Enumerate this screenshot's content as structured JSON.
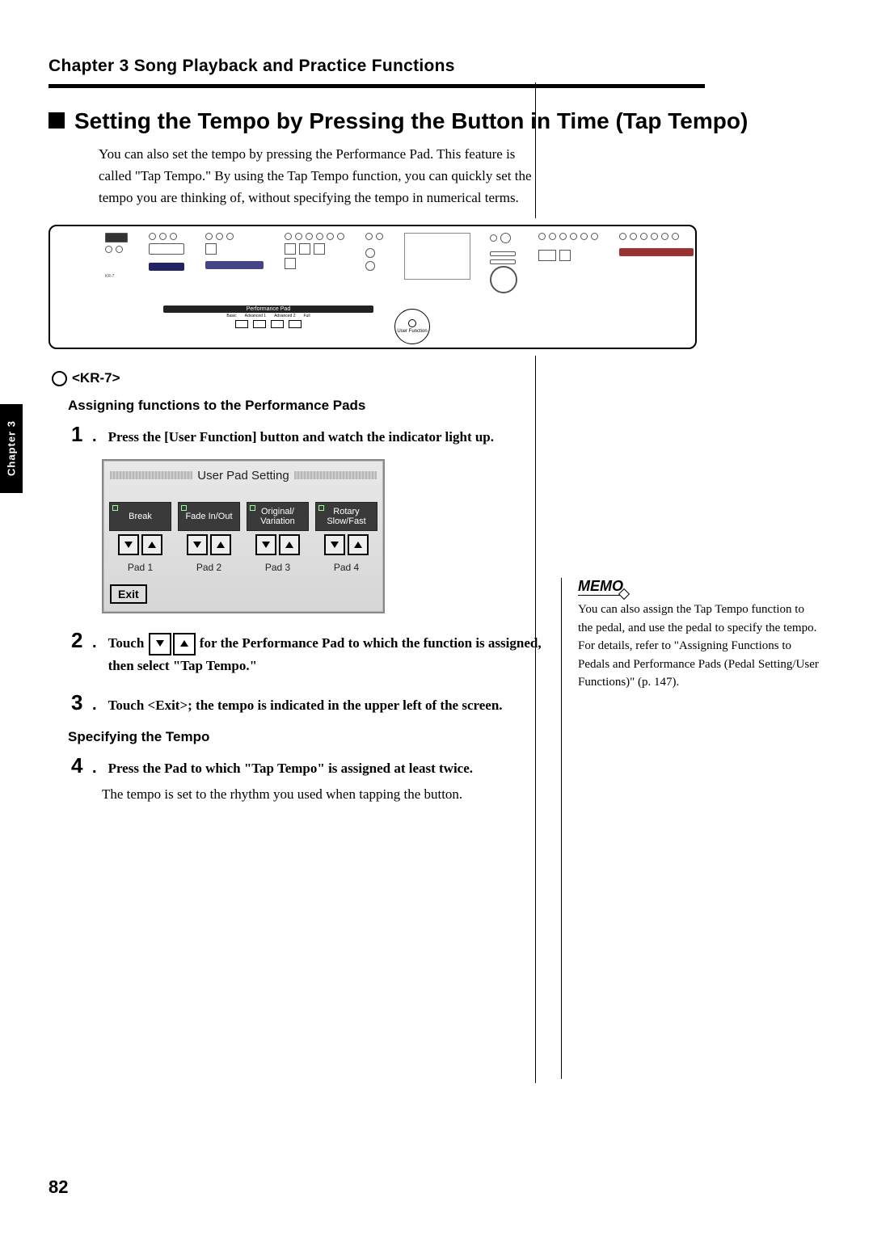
{
  "header": {
    "chapter_line": "Chapter 3 Song Playback and Practice Functions"
  },
  "section": {
    "title": "Setting the Tempo by Pressing the Button in Time (Tap Tempo)",
    "intro": "You can also set the tempo by pressing the Performance Pad. This feature is called \"Tap Tempo.\" By using the Tap Tempo function, you can quickly set the tempo you are thinking of, without specifying the tempo in numerical terms."
  },
  "panel": {
    "perf_label": "Performance Pad",
    "perf_btns": [
      "Basic",
      "Advanced 1",
      "Advanced 2",
      "Full"
    ],
    "circle_label": "User Function",
    "model": "KR-7"
  },
  "kr7": {
    "label": "<KR-7>"
  },
  "sub1": "Assigning functions to the Performance Pads",
  "steps": {
    "s1": "Press the [User Function] button and watch the indicator light up.",
    "s2a": "Touch ",
    "s2b": " for the Performance Pad to which the function is assigned, then select \"Tap Tempo.\"",
    "s3": "Touch <Exit>; the tempo is indicated in the upper left of the screen.",
    "s4": "Press the Pad to which \"Tap Tempo\" is assigned at least twice.",
    "s4_sub": "The tempo is set to the rhythm you used when tapping the button."
  },
  "sub2": "Specifying the Tempo",
  "lcd": {
    "title": "User Pad Setting",
    "pads": [
      {
        "cell": "Break",
        "label": "Pad 1"
      },
      {
        "cell": "Fade In/Out",
        "label": "Pad 2"
      },
      {
        "cell": "Original/\nVariation",
        "label": "Pad 3"
      },
      {
        "cell": "Rotary\nSlow/Fast",
        "label": "Pad 4"
      }
    ],
    "exit": "Exit"
  },
  "memo": {
    "head": "MEMO",
    "text": "You can also assign the Tap Tempo function to the pedal, and use the pedal to specify the tempo. For details, refer to \"Assigning Functions to Pedals and Performance Pads (Pedal Setting/User Functions)\" (p. 147)."
  },
  "side_tab": "Chapter 3",
  "page_number": "82"
}
